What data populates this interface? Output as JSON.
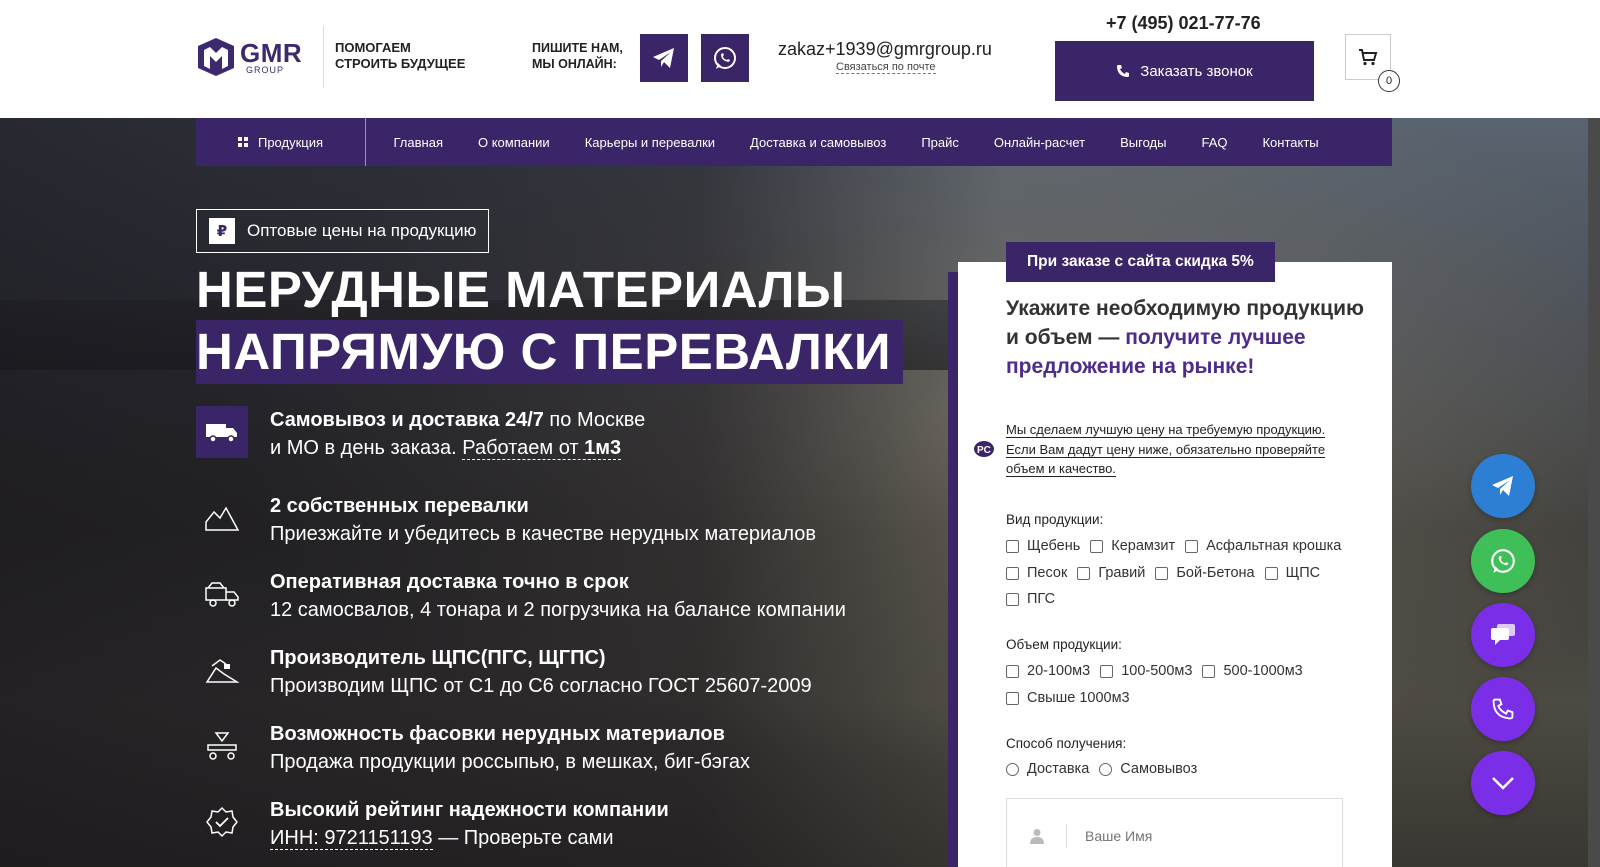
{
  "header": {
    "logo": {
      "brand": "GMR",
      "sub": "GROUP"
    },
    "slogan": [
      "ПОМОГАЕМ",
      "СТРОИТЬ БУДУЩЕЕ"
    ],
    "write_us": [
      "ПИШИТЕ НАМ,",
      "МЫ ОНЛАЙН:"
    ],
    "email": "zakaz+1939@gmrgroup.ru",
    "email_link": "Связаться по почте",
    "phone": "+7 (495) 021-77-76",
    "callback_label": "Заказать звонок",
    "cart_count": "0"
  },
  "nav": {
    "products": "Продукция",
    "items": [
      "Главная",
      "О компании",
      "Карьеры и перевалки",
      "Доставка и самовывоз",
      "Прайс",
      "Онлайн-расчет",
      "Выгоды",
      "FAQ",
      "Контакты"
    ]
  },
  "hero": {
    "wholesale": "Оптовые цены на продукцию",
    "rub_symbol": "₽",
    "title_line1": "НЕРУДНЫЕ МАТЕРИАЛЫ",
    "title_line2": "НАПРЯМУЮ С ПЕРЕВАЛКИ",
    "features": [
      {
        "icon": "truck-icon",
        "bold": "Самовывоз и доставка 24/7",
        "rest1": " по Москве",
        "line2a": "и МО в день заказа. ",
        "line2link": "Работаем от ",
        "line2bold": "1м3"
      },
      {
        "icon": "mountain-icon",
        "bold": "2 собственных перевалки",
        "line2": "Приезжайте и убедитесь в качестве нерудных материалов"
      },
      {
        "icon": "dump-truck-icon",
        "bold": "Оперативная доставка точно в срок",
        "line2": "12 самосвалов, 4 тонара и 2 погрузчика на балансе компании"
      },
      {
        "icon": "excavator-icon",
        "bold": "Производитель ЩПС(ПГС, ЩГПС)",
        "line2": "Производим ЩПС от С1 до С6 согласно ГОСТ 25607-2009"
      },
      {
        "icon": "conveyor-icon",
        "bold": "Возможность фасовки нерудных материалов",
        "line2": "Продажа продукции россыпью, в мешках, биг-бэгах"
      },
      {
        "icon": "badge-check-icon",
        "bold": "Высокий рейтинг надежности компании",
        "line2link": "ИНН: 9721151193",
        "line2rest": " — Проверьте сами"
      }
    ]
  },
  "form": {
    "discount": "При заказе с сайта скидка 5%",
    "head_plain": "Укажите необходимую продукцию и объем — ",
    "head_accent": "получите лучшее предложение на рынке!",
    "note": "Мы сделаем лучшую цену на требуемую продукцию. Если Вам дадут цену ниже, обязательно проверяйте объем и качество.",
    "product_label": "Вид продукции:",
    "products_row1": [
      "Щебень",
      "Керамзит",
      "Асфальтная крошка"
    ],
    "products_row2": [
      "Песок",
      "Гравий",
      "Бой-Бетона",
      "ЩПС"
    ],
    "products_row3": [
      "ПГС"
    ],
    "volume_label": "Объем продукции:",
    "volumes_row1": [
      "20-100м3",
      "100-500м3",
      "500-1000м3"
    ],
    "volumes_row2": [
      "Свыше 1000м3"
    ],
    "method_label": "Способ получения:",
    "methods": [
      "Доставка",
      "Самовывоз"
    ],
    "name_placeholder": "Ваше Имя"
  },
  "colors": {
    "brand": "#3a2568",
    "telegram": "#2d7fd6",
    "whatsapp": "#3fbf58",
    "violet": "#7a2ee8"
  }
}
